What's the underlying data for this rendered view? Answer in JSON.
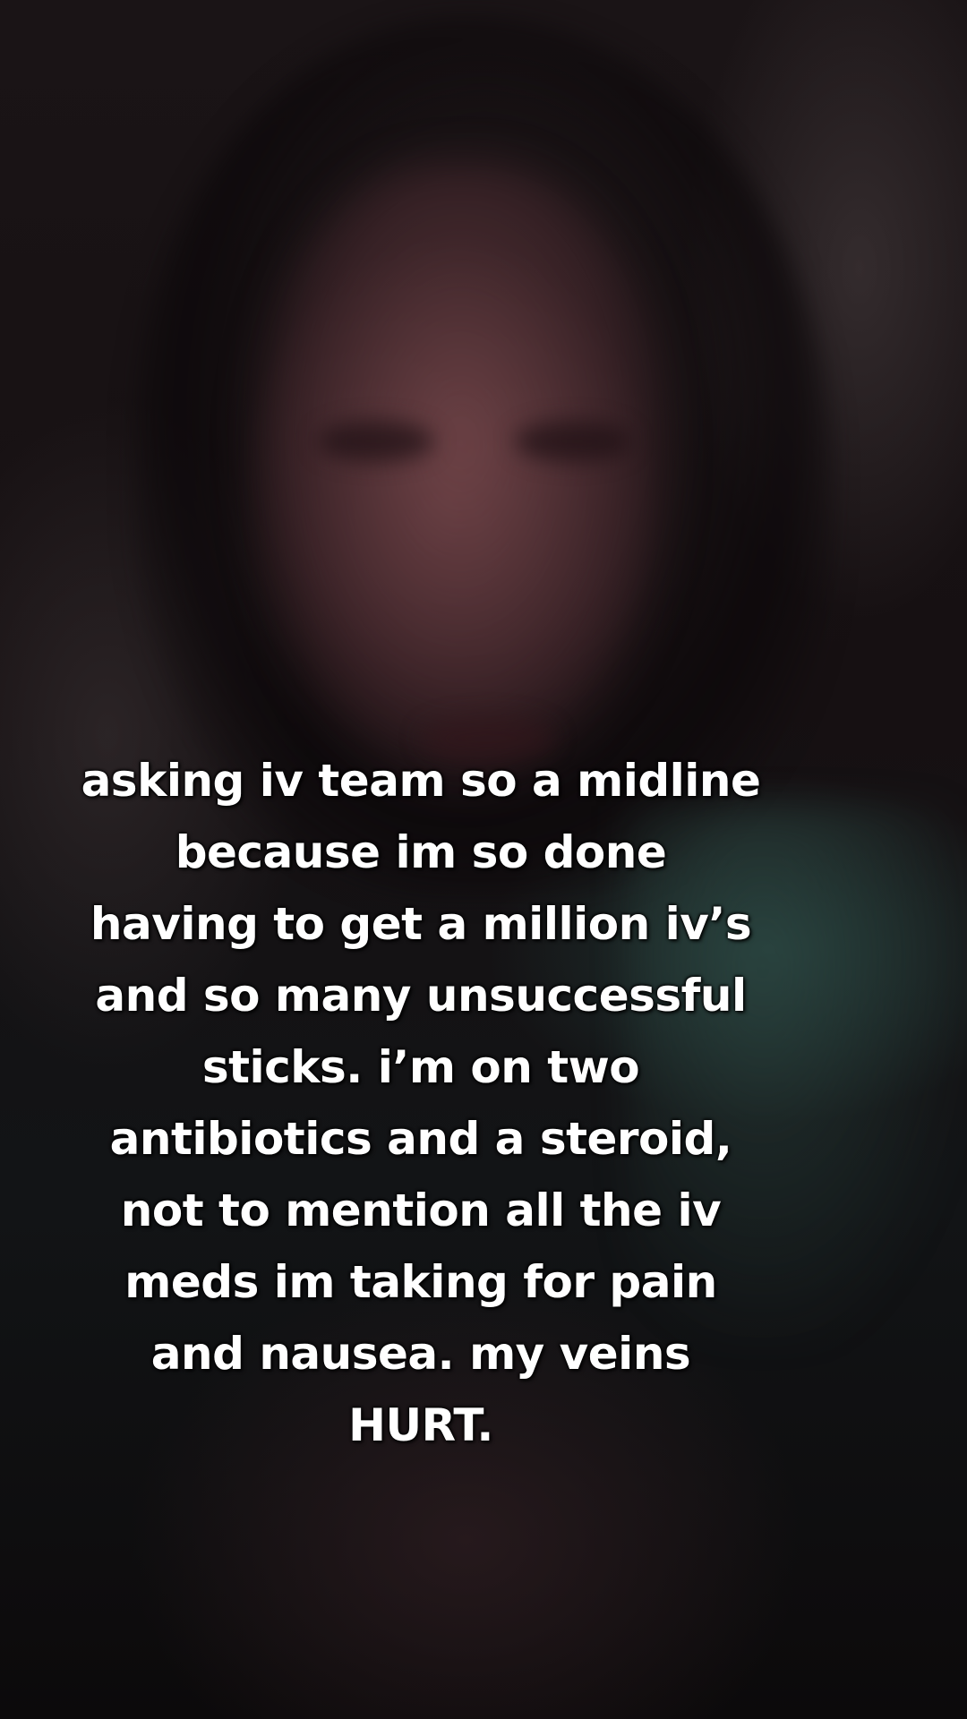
{
  "caption": {
    "lines": [
      "asking iv team so a midline",
      "because im so done",
      "having to get a million iv’s",
      "and so many unsuccessful",
      "sticks. i’m on two",
      "antibiotics and a steroid,",
      "not to mention all the iv",
      "meds im taking for pain",
      "and nausea. my veins",
      "HURT."
    ]
  }
}
